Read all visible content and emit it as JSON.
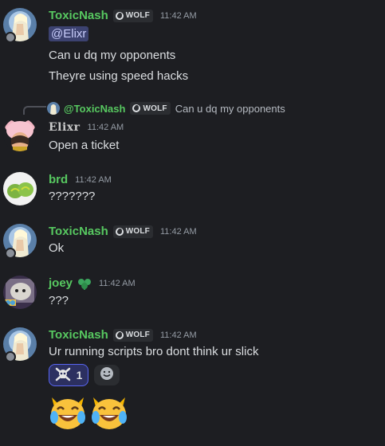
{
  "messages": [
    {
      "author": "ToxicNash",
      "tag": "WOLF",
      "time": "11:42 AM",
      "mention": "@Elixr",
      "lines": [
        "Can u dq my opponents",
        "Theyre using speed hacks"
      ]
    },
    {
      "reply": {
        "author": "@ToxicNash",
        "tag": "WOLF",
        "text": "Can u dq my opponents"
      },
      "author": "Elixr",
      "time": "11:42 AM",
      "lines": [
        "Open a ticket"
      ]
    },
    {
      "author": "brd",
      "time": "11:42 AM",
      "lines": [
        "???????"
      ]
    },
    {
      "author": "ToxicNash",
      "tag": "WOLF",
      "time": "11:42 AM",
      "lines": [
        "Ok"
      ]
    },
    {
      "author": "joey",
      "time": "11:42 AM",
      "lines": [
        "???"
      ]
    },
    {
      "author": "ToxicNash",
      "tag": "WOLF",
      "time": "11:42 AM",
      "lines": [
        "Ur running scripts bro dont think ur slick"
      ],
      "reaction": {
        "emoji": "skull-crossbones",
        "count": "1"
      },
      "big_emojis": [
        "crying-laughing-cat",
        "crying-laughing-cat"
      ]
    }
  ],
  "colors": {
    "background": "#1d1e22",
    "username_green": "#57c860",
    "text": "#dbdee1",
    "muted": "#949ba4",
    "mention_bg": "#3c4270",
    "reaction_border": "#5865f2"
  }
}
